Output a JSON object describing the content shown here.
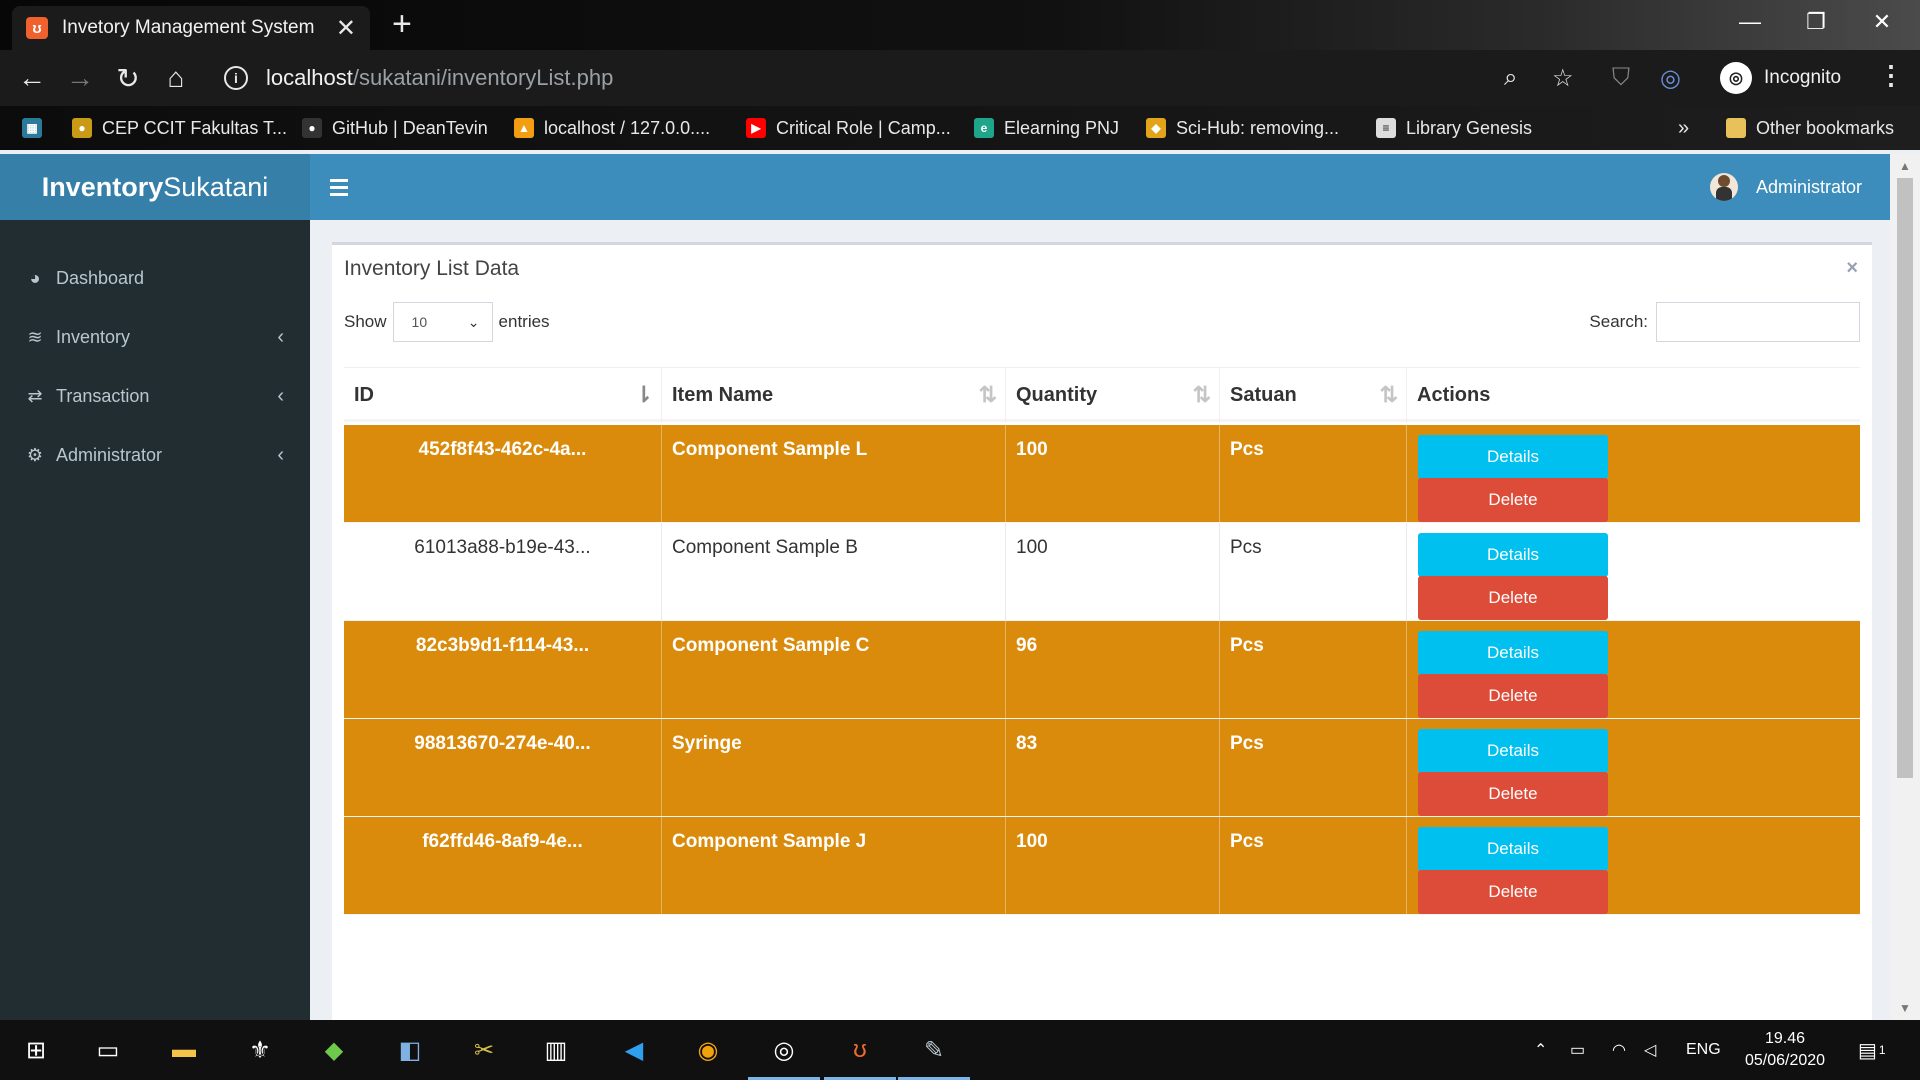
{
  "browser": {
    "tab_title": "Invetory Management System",
    "tab_close": "✕",
    "new_tab": "+",
    "url_host": "localhost",
    "url_path": "/sukatani/inventoryList.php",
    "incognito_label": "Incognito",
    "bookmarks": [
      {
        "label": "CEP CCIT Fakultas T...",
        "icon": "cep-icon",
        "color": "#c99a16"
      },
      {
        "label": "GitHub | DeanTevin",
        "icon": "github-icon",
        "color": "#333333"
      },
      {
        "label": "localhost / 127.0.0....",
        "icon": "phpmyadmin-icon",
        "color": "#f29d12"
      },
      {
        "label": "Critical Role | Camp...",
        "icon": "youtube-icon",
        "color": "#ff0000"
      },
      {
        "label": "Elearning PNJ",
        "icon": "elearning-icon",
        "color": "#1fa58a"
      },
      {
        "label": "Sci-Hub: removing...",
        "icon": "scihub-icon",
        "color": "#e2a419"
      },
      {
        "label": "Library Genesis",
        "icon": "libgen-icon",
        "color": "#dddddd"
      }
    ],
    "bookmarks_overflow": "»",
    "other_bookmarks": "Other bookmarks"
  },
  "app": {
    "logo_bold": "Inventory",
    "logo_light": "Sukatani",
    "user_name": "Administrator",
    "accent_color": "#3c8dbc"
  },
  "sidebar": {
    "items": [
      {
        "label": "Dashboard",
        "icon": "dashboard-icon",
        "has_chevron": false
      },
      {
        "label": "Inventory",
        "icon": "database-icon",
        "has_chevron": true
      },
      {
        "label": "Transaction",
        "icon": "exchange-icon",
        "has_chevron": true
      },
      {
        "label": "Administrator",
        "icon": "cogs-icon",
        "has_chevron": true
      }
    ]
  },
  "panel": {
    "title": "Inventory List Data",
    "close_label": "×",
    "show_label": "Show",
    "entries_value": "10",
    "entries_label": "entries",
    "search_label": "Search:",
    "search_value": ""
  },
  "table": {
    "columns": [
      "ID",
      "Item Name",
      "Quantity",
      "Satuan",
      "Actions"
    ],
    "details_label": "Details",
    "delete_label": "Delete",
    "highlight_color": "#db8b0b",
    "rows": [
      {
        "id": "452f8f43-462c-4a...",
        "name": "Component Sample L",
        "qty": "100",
        "unit": "Pcs",
        "highlighted": true
      },
      {
        "id": "61013a88-b19e-43...",
        "name": "Component Sample B",
        "qty": "100",
        "unit": "Pcs",
        "highlighted": false
      },
      {
        "id": "82c3b9d1-f114-43...",
        "name": "Component Sample C",
        "qty": "96",
        "unit": "Pcs",
        "highlighted": true
      },
      {
        "id": "98813670-274e-40...",
        "name": "Syringe",
        "qty": "83",
        "unit": "Pcs",
        "highlighted": true
      },
      {
        "id": "f62ffd46-8af9-4e...",
        "name": "Component Sample J",
        "qty": "100",
        "unit": "Pcs",
        "highlighted": true
      }
    ]
  },
  "taskbar": {
    "lang": "ENG",
    "time": "19.46",
    "date": "05/06/2020",
    "notification_count": "1"
  }
}
